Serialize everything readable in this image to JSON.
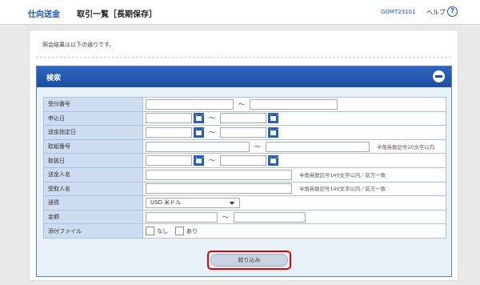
{
  "header": {
    "brand": "仕向送金",
    "title": "取引一覧［長期保存］",
    "screen_id": "GOMT23101",
    "help_label": "ヘルプ",
    "help_icon": "?"
  },
  "intro_text": "照会結果は以下の通りです。",
  "search_panel": {
    "title": "検索",
    "fields": [
      {
        "label": "受付番号"
      },
      {
        "label": "申込日"
      },
      {
        "label": "送金指定日"
      },
      {
        "label": "取組番号",
        "hint": "半角英数記号20文字以内"
      },
      {
        "label": "取扱日"
      },
      {
        "label": "送金人名",
        "hint": "半角英数記号140文字以内／前方一致"
      },
      {
        "label": "受取人名",
        "hint": "半角英数記号140文字以内／前方一致"
      },
      {
        "label": "通貨",
        "value": "USD  米ドル"
      },
      {
        "label": "金額"
      },
      {
        "label": "添付ファイル",
        "options": [
          "なし",
          "あり"
        ]
      }
    ],
    "range_separator": "～",
    "filter_button": "絞り込み"
  },
  "colors": {
    "brand_blue": "#1a56b4",
    "panel_header": "#2f66c0",
    "label_bg": "#cddcf0",
    "highlight": "#e00000"
  },
  "icons": [
    "help-icon",
    "collapse-icon",
    "calendar-icon",
    "dropdown-arrow-icon"
  ]
}
